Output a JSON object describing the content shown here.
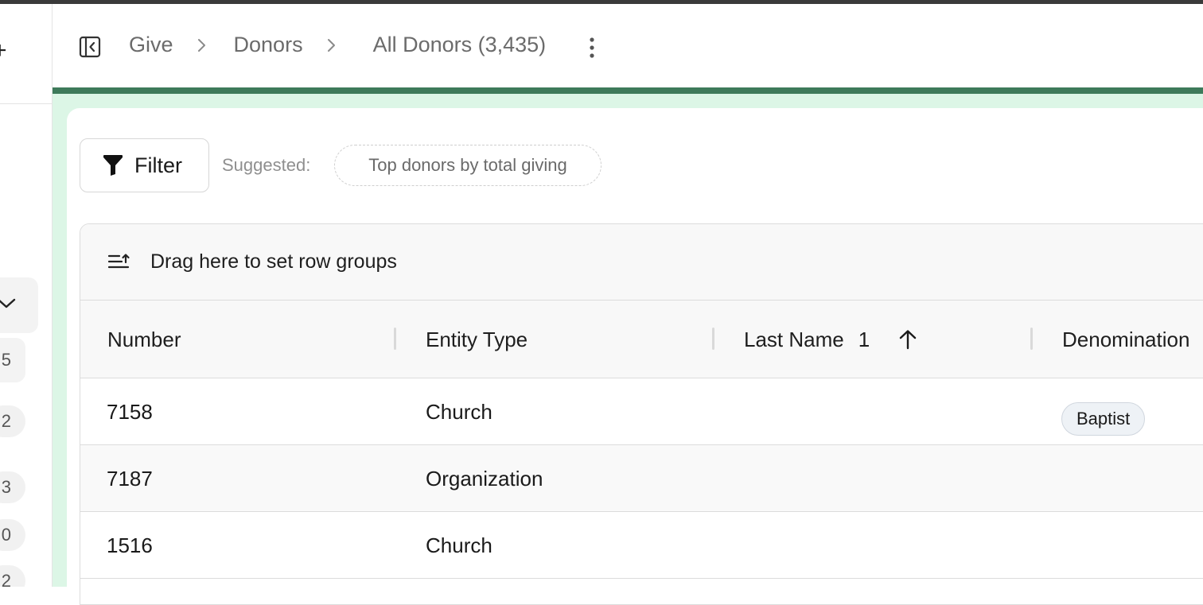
{
  "sidebar": {
    "counts": [
      "5",
      "2",
      "3",
      "0",
      "2"
    ]
  },
  "header": {
    "breadcrumbs": [
      {
        "label": "Give"
      },
      {
        "label": "Donors"
      },
      {
        "label": "All Donors (3,435)"
      }
    ]
  },
  "toolbar": {
    "filter_label": "Filter",
    "suggested_label": "Suggested:",
    "suggestion": "Top donors by total giving"
  },
  "grid": {
    "group_hint": "Drag here to set row groups",
    "columns": [
      {
        "label": "Number"
      },
      {
        "label": "Entity Type"
      },
      {
        "label": "Last Name",
        "sort_order": "1",
        "sort_dir": "asc"
      },
      {
        "label": "Denomination"
      }
    ],
    "rows": [
      {
        "number": "7158",
        "entity_type": "Church",
        "last_name": "",
        "denomination": "Baptist"
      },
      {
        "number": "7187",
        "entity_type": "Organization",
        "last_name": "",
        "denomination": ""
      },
      {
        "number": "1516",
        "entity_type": "Church",
        "last_name": "",
        "denomination": ""
      }
    ]
  },
  "colors": {
    "accent_green": "#3e7a5a",
    "mint_background": "#dcf6e6"
  }
}
